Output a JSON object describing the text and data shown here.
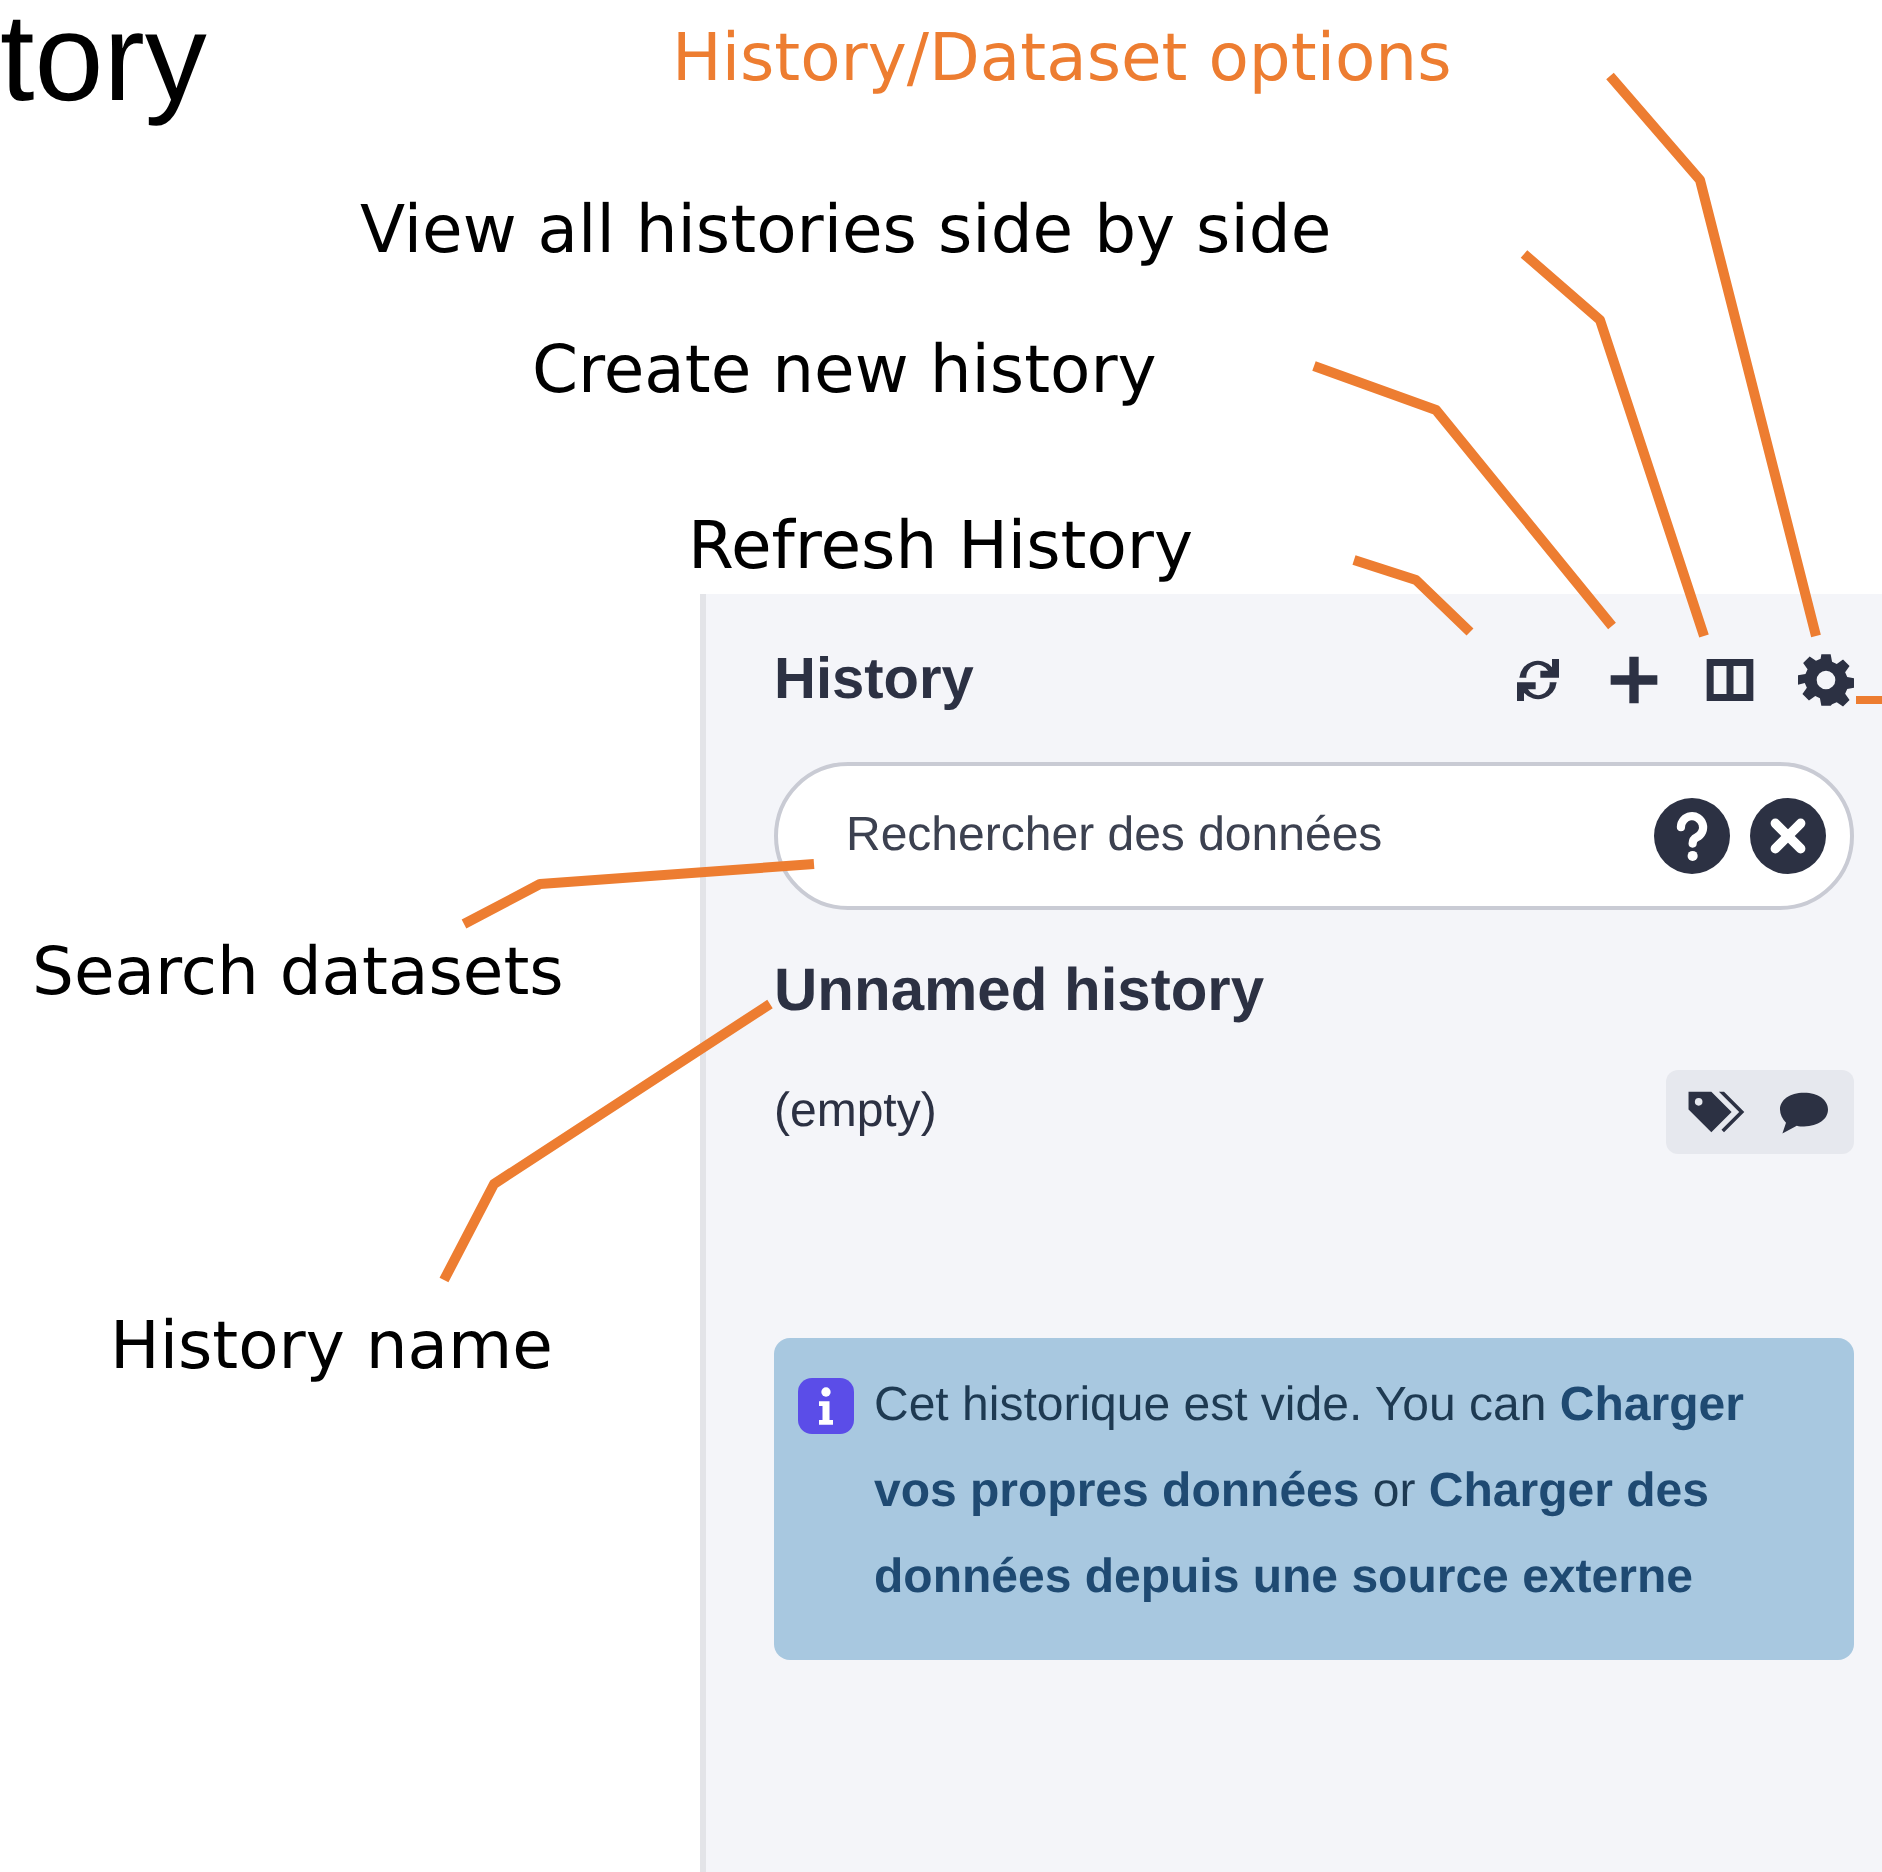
{
  "slide_title": "tory",
  "annotations": [
    {
      "text": "History/Dataset options",
      "color": "#ed7d31"
    },
    {
      "text": "View all histories side by side",
      "color": "#000000"
    },
    {
      "text": "Create new history",
      "color": "#000000"
    },
    {
      "text": "Refresh History",
      "color": "#000000"
    },
    {
      "text": "Search datasets",
      "color": "#000000"
    },
    {
      "text": "History name",
      "color": "#000000"
    }
  ],
  "history_panel": {
    "title": "History",
    "search": {
      "placeholder": "Rechercher des données"
    },
    "history_name": "Unnamed history",
    "size": "(empty)",
    "alert": "Cet historique est vide. You can **Charger vos propres données** or **Charger des données depuis une source externe**"
  }
}
